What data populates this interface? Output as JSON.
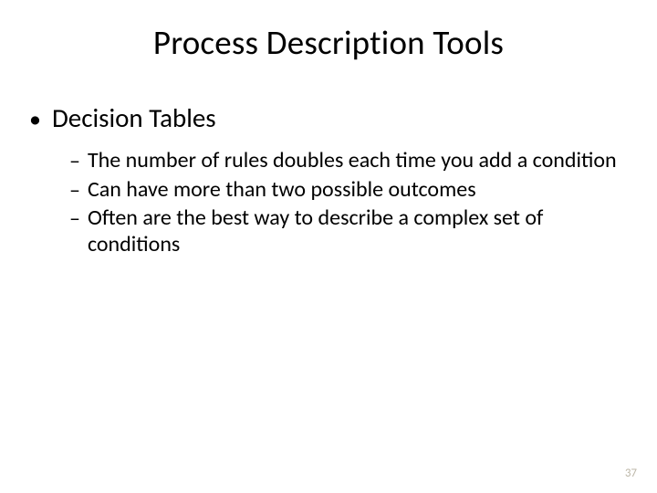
{
  "slide": {
    "title": "Process Description Tools",
    "bullet1": {
      "label": "Decision Tables",
      "subitems": [
        "The number of rules doubles each time you add a condition",
        "Can have more than two possible outcomes",
        "Often are the best way to describe a complex set of conditions"
      ]
    },
    "page_number": "37"
  }
}
